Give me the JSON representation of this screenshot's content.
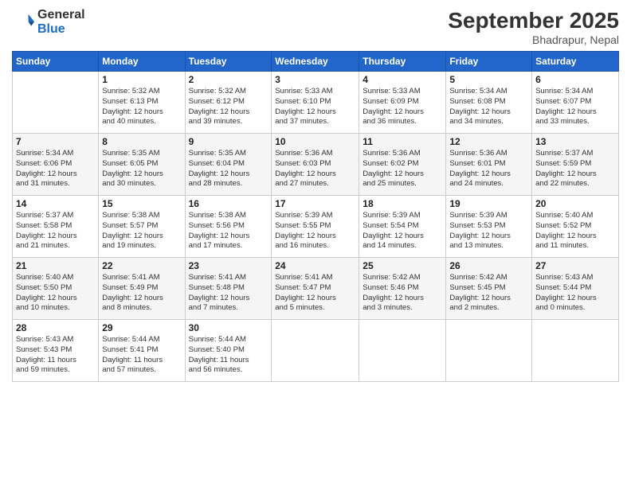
{
  "header": {
    "logo_line1": "General",
    "logo_line2": "Blue",
    "month_title": "September 2025",
    "location": "Bhadrapur, Nepal"
  },
  "weekdays": [
    "Sunday",
    "Monday",
    "Tuesday",
    "Wednesday",
    "Thursday",
    "Friday",
    "Saturday"
  ],
  "weeks": [
    [
      {
        "day": "",
        "info": ""
      },
      {
        "day": "1",
        "info": "Sunrise: 5:32 AM\nSunset: 6:13 PM\nDaylight: 12 hours\nand 40 minutes."
      },
      {
        "day": "2",
        "info": "Sunrise: 5:32 AM\nSunset: 6:12 PM\nDaylight: 12 hours\nand 39 minutes."
      },
      {
        "day": "3",
        "info": "Sunrise: 5:33 AM\nSunset: 6:10 PM\nDaylight: 12 hours\nand 37 minutes."
      },
      {
        "day": "4",
        "info": "Sunrise: 5:33 AM\nSunset: 6:09 PM\nDaylight: 12 hours\nand 36 minutes."
      },
      {
        "day": "5",
        "info": "Sunrise: 5:34 AM\nSunset: 6:08 PM\nDaylight: 12 hours\nand 34 minutes."
      },
      {
        "day": "6",
        "info": "Sunrise: 5:34 AM\nSunset: 6:07 PM\nDaylight: 12 hours\nand 33 minutes."
      }
    ],
    [
      {
        "day": "7",
        "info": "Sunrise: 5:34 AM\nSunset: 6:06 PM\nDaylight: 12 hours\nand 31 minutes."
      },
      {
        "day": "8",
        "info": "Sunrise: 5:35 AM\nSunset: 6:05 PM\nDaylight: 12 hours\nand 30 minutes."
      },
      {
        "day": "9",
        "info": "Sunrise: 5:35 AM\nSunset: 6:04 PM\nDaylight: 12 hours\nand 28 minutes."
      },
      {
        "day": "10",
        "info": "Sunrise: 5:36 AM\nSunset: 6:03 PM\nDaylight: 12 hours\nand 27 minutes."
      },
      {
        "day": "11",
        "info": "Sunrise: 5:36 AM\nSunset: 6:02 PM\nDaylight: 12 hours\nand 25 minutes."
      },
      {
        "day": "12",
        "info": "Sunrise: 5:36 AM\nSunset: 6:01 PM\nDaylight: 12 hours\nand 24 minutes."
      },
      {
        "day": "13",
        "info": "Sunrise: 5:37 AM\nSunset: 5:59 PM\nDaylight: 12 hours\nand 22 minutes."
      }
    ],
    [
      {
        "day": "14",
        "info": "Sunrise: 5:37 AM\nSunset: 5:58 PM\nDaylight: 12 hours\nand 21 minutes."
      },
      {
        "day": "15",
        "info": "Sunrise: 5:38 AM\nSunset: 5:57 PM\nDaylight: 12 hours\nand 19 minutes."
      },
      {
        "day": "16",
        "info": "Sunrise: 5:38 AM\nSunset: 5:56 PM\nDaylight: 12 hours\nand 17 minutes."
      },
      {
        "day": "17",
        "info": "Sunrise: 5:39 AM\nSunset: 5:55 PM\nDaylight: 12 hours\nand 16 minutes."
      },
      {
        "day": "18",
        "info": "Sunrise: 5:39 AM\nSunset: 5:54 PM\nDaylight: 12 hours\nand 14 minutes."
      },
      {
        "day": "19",
        "info": "Sunrise: 5:39 AM\nSunset: 5:53 PM\nDaylight: 12 hours\nand 13 minutes."
      },
      {
        "day": "20",
        "info": "Sunrise: 5:40 AM\nSunset: 5:52 PM\nDaylight: 12 hours\nand 11 minutes."
      }
    ],
    [
      {
        "day": "21",
        "info": "Sunrise: 5:40 AM\nSunset: 5:50 PM\nDaylight: 12 hours\nand 10 minutes."
      },
      {
        "day": "22",
        "info": "Sunrise: 5:41 AM\nSunset: 5:49 PM\nDaylight: 12 hours\nand 8 minutes."
      },
      {
        "day": "23",
        "info": "Sunrise: 5:41 AM\nSunset: 5:48 PM\nDaylight: 12 hours\nand 7 minutes."
      },
      {
        "day": "24",
        "info": "Sunrise: 5:41 AM\nSunset: 5:47 PM\nDaylight: 12 hours\nand 5 minutes."
      },
      {
        "day": "25",
        "info": "Sunrise: 5:42 AM\nSunset: 5:46 PM\nDaylight: 12 hours\nand 3 minutes."
      },
      {
        "day": "26",
        "info": "Sunrise: 5:42 AM\nSunset: 5:45 PM\nDaylight: 12 hours\nand 2 minutes."
      },
      {
        "day": "27",
        "info": "Sunrise: 5:43 AM\nSunset: 5:44 PM\nDaylight: 12 hours\nand 0 minutes."
      }
    ],
    [
      {
        "day": "28",
        "info": "Sunrise: 5:43 AM\nSunset: 5:43 PM\nDaylight: 11 hours\nand 59 minutes."
      },
      {
        "day": "29",
        "info": "Sunrise: 5:44 AM\nSunset: 5:41 PM\nDaylight: 11 hours\nand 57 minutes."
      },
      {
        "day": "30",
        "info": "Sunrise: 5:44 AM\nSunset: 5:40 PM\nDaylight: 11 hours\nand 56 minutes."
      },
      {
        "day": "",
        "info": ""
      },
      {
        "day": "",
        "info": ""
      },
      {
        "day": "",
        "info": ""
      },
      {
        "day": "",
        "info": ""
      }
    ]
  ]
}
